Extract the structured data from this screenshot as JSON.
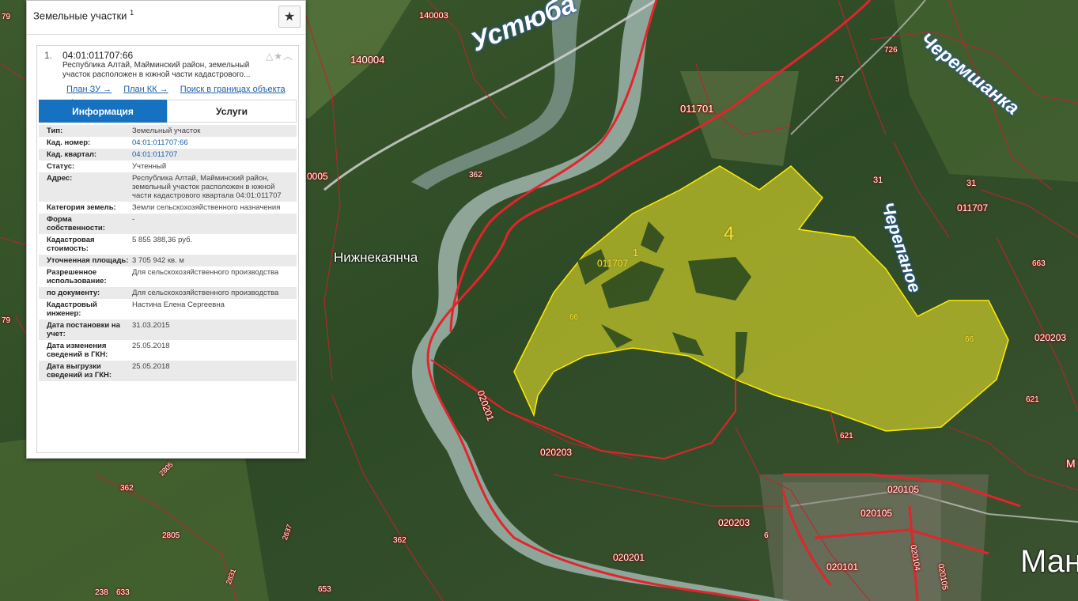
{
  "panel": {
    "title": "Земельные участки",
    "title_sup": "1",
    "star_icon": "star-icon",
    "item": {
      "index": "1.",
      "cad_number": "04:01:011707:66",
      "address_short": "Республика Алтай, Майминский район, земельный участок расположен в южной части кадастрового...",
      "links": [
        "План ЗУ →",
        "План КК →",
        "Поиск в границах объекта →"
      ]
    },
    "tabs": {
      "info": "Информация",
      "services": "Услуги"
    },
    "rows": [
      {
        "k": "Тип:",
        "v": "Земельный участок",
        "link": false
      },
      {
        "k": "Кад. номер:",
        "v": "04:01:011707:66",
        "link": true
      },
      {
        "k": "Кад. квартал:",
        "v": "04:01:011707",
        "link": true
      },
      {
        "k": "Статус:",
        "v": "Учтенный",
        "link": false
      },
      {
        "k": "Адрес:",
        "v": "Республика Алтай, Майминский район, земельный участок расположен в южной части кадастрового квартала 04:01:011707",
        "link": false
      },
      {
        "k": "Категория земель:",
        "v": "Земли сельскохозяйственного назначения",
        "link": false
      },
      {
        "k": "Форма собственности:",
        "v": "-",
        "link": false
      },
      {
        "k": "Кадастровая стоимость:",
        "v": "5 855 388,36 руб.",
        "link": false
      },
      {
        "k": "Уточненная площадь:",
        "v": "3 705 942 кв. м",
        "link": false
      },
      {
        "k": "Разрешенное использование:",
        "v": "Для сельскохозяйственного производства",
        "link": false
      },
      {
        "k": "по документу:",
        "v": "Для сельскохозяйственного производства",
        "link": false
      },
      {
        "k": "Кадастровый инженер:",
        "v": "Настина Елена Сергеевна",
        "link": false
      },
      {
        "k": "Дата постановки на учет:",
        "v": "31.03.2015",
        "link": false
      },
      {
        "k": "Дата изменения сведений в ГКН:",
        "v": "25.05.2018",
        "link": false
      },
      {
        "k": "Дата выгрузки сведений из ГКН:",
        "v": "25.05.2018",
        "link": false
      }
    ]
  },
  "map": {
    "rivers": [
      "Устюба",
      "Черемшанка",
      "Черепаное"
    ],
    "places": [
      "Нижнекаянча",
      "Ман"
    ],
    "parcel_labels": [
      "4",
      "1",
      "011707",
      "66",
      "66"
    ],
    "cad_labels": [
      "140003",
      "140004",
      "726",
      "57",
      "011701",
      "362",
      "31",
      "31",
      "011707",
      "0005",
      "663",
      "020203",
      "621",
      "621",
      "020201",
      "020203",
      "020105",
      "020105",
      "020203",
      "6",
      "020201",
      "362",
      "020101",
      "020104",
      "020105",
      "362",
      "2805",
      "2637",
      "2831",
      "2805",
      "633",
      "238",
      "653",
      "79",
      "79",
      "M"
    ],
    "colors": {
      "parcel_fill": "#e6e12a",
      "boundary": "#e3242b"
    }
  }
}
